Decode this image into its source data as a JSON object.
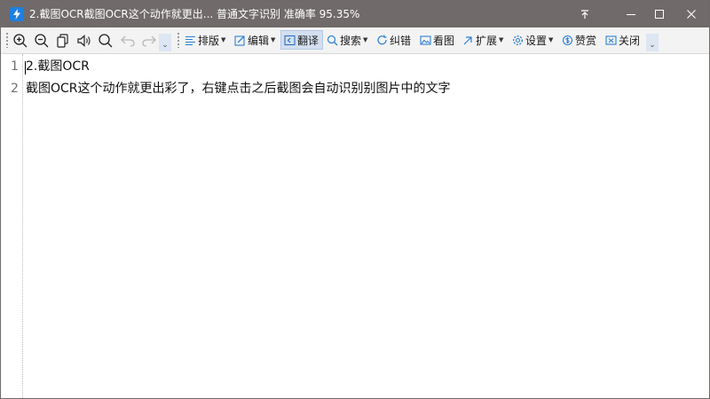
{
  "window": {
    "title": "2.截图OCR截图OCR这个动作就更出...   普通文字识别  准确率 95.35%",
    "buttons": [
      "pin",
      "minimize",
      "maximize",
      "close"
    ]
  },
  "toolbar": {
    "icons": [
      "zoom-in-icon",
      "zoom-out-icon",
      "copy-icon",
      "speaker-icon",
      "search-icon",
      "undo-icon",
      "redo-icon"
    ],
    "items": [
      {
        "label": "排版",
        "icon": "align-icon",
        "dropdown": true
      },
      {
        "label": "编辑",
        "icon": "edit-icon",
        "dropdown": true
      },
      {
        "label": "翻译",
        "icon": "translate-icon",
        "dropdown": false,
        "active": true
      },
      {
        "label": "搜索",
        "icon": "search-icon",
        "dropdown": true
      },
      {
        "label": "纠错",
        "icon": "refresh-icon",
        "dropdown": false
      },
      {
        "label": "看图",
        "icon": "image-icon",
        "dropdown": false
      },
      {
        "label": "扩展",
        "icon": "extend-icon",
        "dropdown": true
      },
      {
        "label": "设置",
        "icon": "gear-icon",
        "dropdown": true
      },
      {
        "label": "赞赏",
        "icon": "coin-icon",
        "dropdown": false
      },
      {
        "label": "关闭",
        "icon": "close-icon",
        "dropdown": false
      }
    ],
    "more_glyph": "⌄"
  },
  "editor": {
    "lines": [
      {
        "number": "1",
        "text": "2.截图OCR"
      },
      {
        "number": "2",
        "text": "截图OCR这个动作就更出彩了，右键点击之后截图会自动识别别图片中的文字"
      }
    ]
  },
  "colors": {
    "titlebar": "#706b6a",
    "toolbar": "#f3f3f3",
    "active_button": "#d3dff0",
    "icon_blue": "#1d7fe0"
  }
}
